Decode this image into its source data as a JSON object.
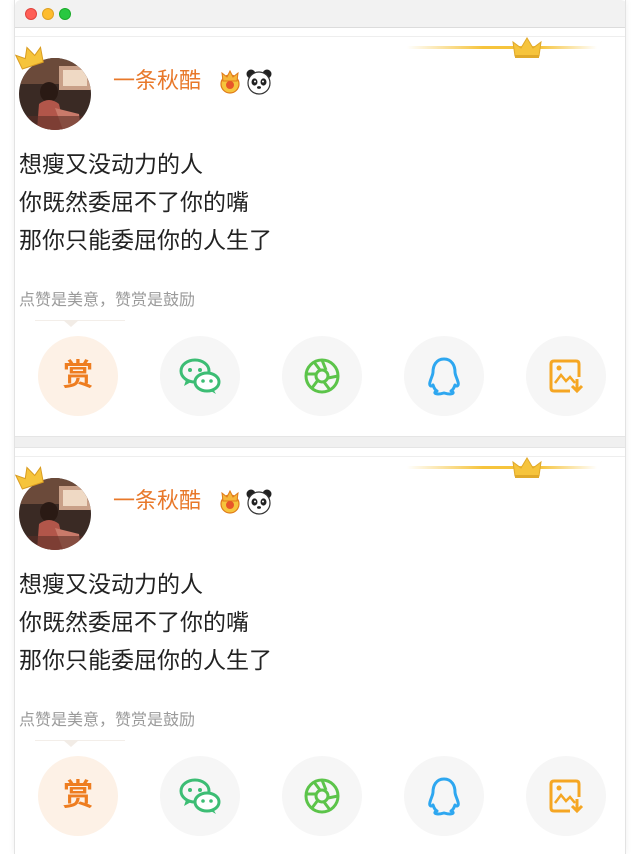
{
  "colors": {
    "accent": "#e8782a",
    "reward": "#ee7d20",
    "wechat": "#3cbd74",
    "moments": "#5cc44a",
    "qq": "#2ea7f0",
    "save": "#f5a623",
    "crown_gold": "#f6c43c"
  },
  "posts": [
    {
      "username": "一条秋酷",
      "lines": [
        "想瘦又没动力的人",
        "你既然委屈不了你的嘴",
        "那你只能委屈你的人生了"
      ],
      "reward_hint": "点赞是美意，赞赏是鼓励",
      "reward_label": "赏",
      "actions": [
        "reward-icon",
        "wechat-icon",
        "moments-icon",
        "qq-icon",
        "save-image-icon"
      ]
    },
    {
      "username": "一条秋酷",
      "lines": [
        "想瘦又没动力的人",
        "你既然委屈不了你的嘴",
        "那你只能委屈你的人生了"
      ],
      "reward_hint": "点赞是美意，赞赏是鼓励",
      "reward_label": "赏",
      "actions": [
        "reward-icon",
        "wechat-icon",
        "moments-icon",
        "qq-icon",
        "save-image-icon"
      ]
    }
  ]
}
